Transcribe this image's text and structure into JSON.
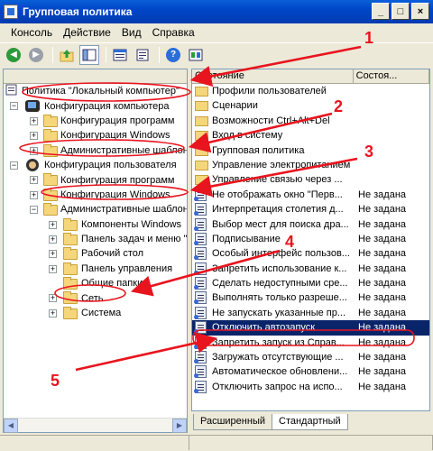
{
  "window": {
    "title": "Групповая политика",
    "buttons": [
      "_",
      "□",
      "×"
    ]
  },
  "menu": [
    "Консоль",
    "Действие",
    "Вид",
    "Справка"
  ],
  "toolbar": {
    "icons": [
      "back-icon",
      "forward-icon",
      "up-folder-icon",
      "show-hide-tree-icon",
      "properties-icon",
      "export-list-icon",
      "help-icon",
      "show-extended-icon"
    ]
  },
  "tree": {
    "root": "Политика \"Локальный компьютер\"",
    "nodes": [
      {
        "label": "Конфигурация компьютера"
      },
      {
        "label": "Конфигурация программ"
      },
      {
        "label": "Конфигурация Windows"
      },
      {
        "label": "Административные шаблоны"
      },
      {
        "label": "Конфигурация пользователя"
      },
      {
        "label": "Конфигурация программ"
      },
      {
        "label": "Конфигурация Windows"
      },
      {
        "label": "Административные шаблоны"
      },
      {
        "label": "Компоненты Windows"
      },
      {
        "label": "Панель задач и меню \"Пуск\""
      },
      {
        "label": "Рабочий стол"
      },
      {
        "label": "Панель управления"
      },
      {
        "label": "Общие папки"
      },
      {
        "label": "Сеть"
      },
      {
        "label": "Система"
      }
    ]
  },
  "list": {
    "col_name": "Состояние",
    "col_state": "Состоя...",
    "rows": [
      {
        "name": "Профили пользователей",
        "state": ""
      },
      {
        "name": "Сценарии",
        "state": ""
      },
      {
        "name": "Возможности Ctrl+Alt+Del",
        "state": ""
      },
      {
        "name": "Вход в систему",
        "state": ""
      },
      {
        "name": "Групповая политика",
        "state": ""
      },
      {
        "name": "Управление электропитанием",
        "state": ""
      },
      {
        "name": "Управление связью через ...",
        "state": ""
      },
      {
        "name": "Не отображать окно \"Перв...",
        "state": "Не задана"
      },
      {
        "name": "Интерпретация столетия д...",
        "state": "Не задана"
      },
      {
        "name": "Выбор мест для поиска дра...",
        "state": "Не задана"
      },
      {
        "name": "Подписывание",
        "state": "Не задана"
      },
      {
        "name": "Особый интерфейс пользов...",
        "state": "Не задана"
      },
      {
        "name": "Запретить использование к...",
        "state": "Не задана"
      },
      {
        "name": "Сделать недоступными сре...",
        "state": "Не задана"
      },
      {
        "name": "Выполнять только разреше...",
        "state": "Не задана"
      },
      {
        "name": "Не запускать указанные пр...",
        "state": "Не задана"
      },
      {
        "name": "Отключить автозапуск",
        "state": "Не задана"
      },
      {
        "name": "Запретить запуск из Справ...",
        "state": "Не задана"
      },
      {
        "name": "Загружать отсутствующие ...",
        "state": "Не задана"
      },
      {
        "name": "Автоматическое обновлени...",
        "state": "Не задана"
      },
      {
        "name": "Отключить запрос на испо...",
        "state": "Не задана"
      }
    ]
  },
  "tabs": [
    "Расширенный",
    "Стандартный"
  ],
  "annotations": [
    "1",
    "2",
    "3",
    "4",
    "5"
  ],
  "colors": {
    "accent": "#0a246a",
    "highlight": "#e8141e"
  }
}
